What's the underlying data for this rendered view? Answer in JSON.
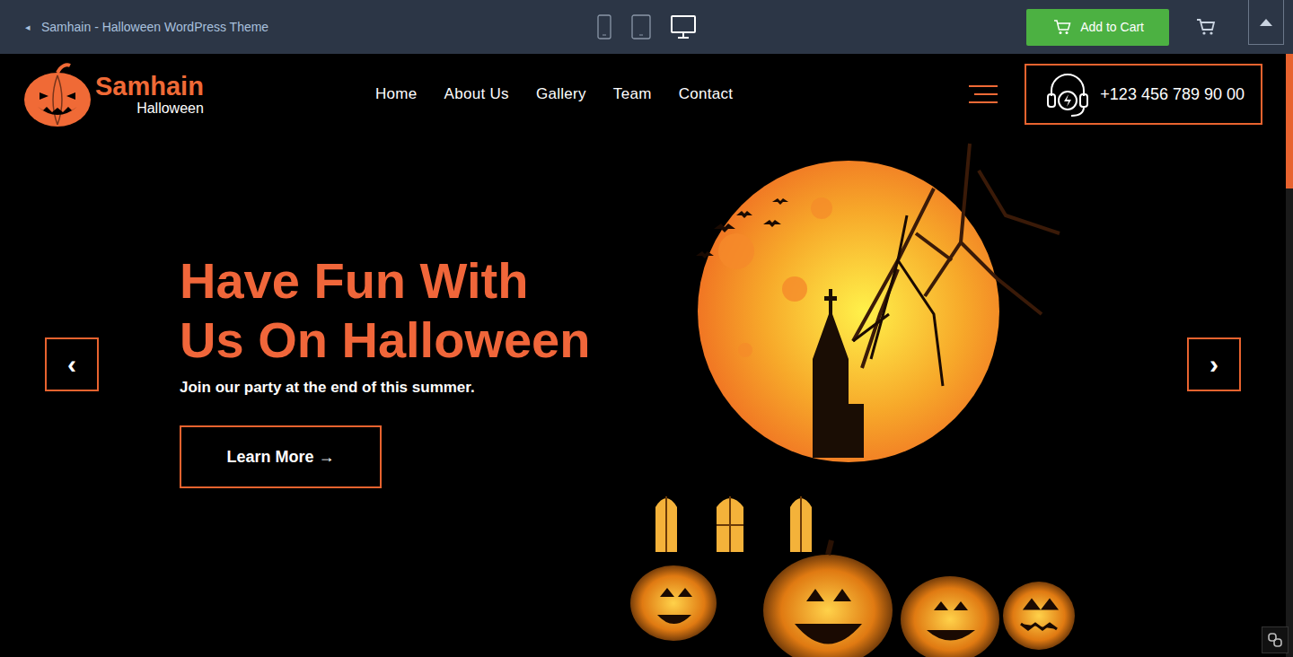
{
  "preview_bar": {
    "back_icon": "◂",
    "title": "Samhain - Halloween WordPress Theme",
    "devices": [
      {
        "kind": "phone",
        "selected": false
      },
      {
        "kind": "tablet",
        "selected": false
      },
      {
        "kind": "desktop",
        "selected": true
      }
    ],
    "add_to_cart": "Add to Cart"
  },
  "header": {
    "logo": {
      "name": "Samhain",
      "tagline": "Halloween"
    },
    "nav": [
      {
        "label": "Home"
      },
      {
        "label": "About Us"
      },
      {
        "label": "Gallery"
      },
      {
        "label": "Team"
      },
      {
        "label": "Contact"
      }
    ],
    "phone": "+123 456 789 90 00"
  },
  "hero": {
    "title_lines": [
      "Have Fun With",
      "Us On Halloween"
    ],
    "subtitle": "Join our party at the end of this summer.",
    "button": "Learn More →",
    "prev": "‹",
    "next": "›"
  }
}
